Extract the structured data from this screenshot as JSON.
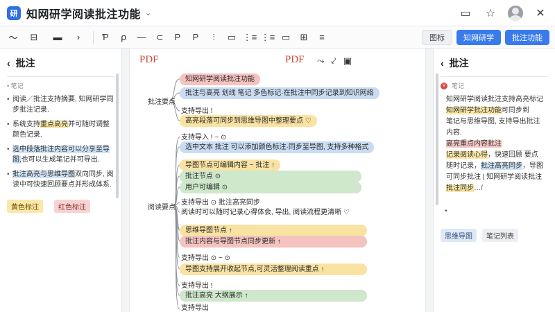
{
  "app": {
    "title": "知网研学阅读批注功能",
    "logo_glyph": "研"
  },
  "toolbar": {
    "tools": [
      "〜",
      "⊟",
      "▬",
      "›",
      "Ƥ",
      "⍴",
      "—",
      "⊂",
      "P",
      "P",
      "⫶",
      "▭",
      "⋮≡",
      "⋮≡",
      "▭",
      "⊞",
      "≡"
    ],
    "btn_ghost": "图标",
    "btn_primary_1": "知网研学",
    "btn_primary_2": "批注功能"
  },
  "left_panel": {
    "title": "批注",
    "sub": "• 笔记",
    "notes": [
      {
        "pre": "",
        "hl": "",
        "hl_color": "",
        "post": "阅读／批注支持摘要, 知网研学同步批注记录."
      },
      {
        "pre": "系统支持",
        "hl": "重点高亮",
        "hl_color": "y",
        "post": "并可随时调整颜色记录."
      },
      {
        "pre": "",
        "hl": "选中段落批注内容可以分享至导图,",
        "hl_color": "b",
        "post": "也可以生成笔记并可导出."
      },
      {
        "pre": "",
        "hl": "批注高亮与思维导图",
        "hl_color": "b",
        "post": "双向同步, 阅读中可快速回顾要点并形成体系."
      }
    ],
    "chip_1": "黄色标注",
    "chip_2": "红色标注"
  },
  "center": {
    "pdf_left": "PDF",
    "pdf_right": "PDF",
    "tools": [
      "⤳",
      "⤦",
      "▣"
    ],
    "branch_1": "批注要点",
    "branch_2": "阅读要点",
    "nodes": [
      {
        "text": "知网研学阅读批注功能",
        "color": "r"
      },
      {
        "text": "批注与高亮 划线 笔记 多色标记·在批注中同步记录到知识网络",
        "color": "b"
      },
      {
        "text": "支持导出 !",
        "color": "plain"
      },
      {
        "text": "高亮段落可同步到思维导图中整理要点 ♡",
        "color": "y"
      },
      {
        "text": "支持导入 ! ~ ⊙",
        "color": "plain"
      },
      {
        "text": "选中文本 批注 可以添加颜色标注·同步至导图, 支持多种格式",
        "color": "b"
      },
      {
        "text": "导图节点可编辑内容 ~ 批注 ↑",
        "color": "y"
      },
      {
        "text": "批注节点 ⊙",
        "color": "g"
      },
      {
        "text": "用户可编辑 ⊙",
        "color": "g"
      },
      {
        "text": "支持导出 ⊙ 批注高亮同步",
        "color": "plain"
      },
      {
        "text": "阅读时可以随时记录心得体会, 导出, 阅读流程更清晰 ♡",
        "color": "plain"
      },
      {
        "text": "思维导图节点 ↑",
        "color": "y"
      },
      {
        "text": "批注内容与导图节点同步更新 ↑",
        "color": "r"
      },
      {
        "text": "支持导出 ⊙ ~ ⊙",
        "color": "plain"
      },
      {
        "text": "导图支持展开收起节点,可灵活整理阅读重点 ↑",
        "color": "y"
      },
      {
        "text": "支持导出 !",
        "color": "plain"
      },
      {
        "text": "批注高亮 大纲展示 ↑",
        "color": "g"
      },
      {
        "text": "支持导出",
        "color": "plain"
      }
    ]
  },
  "right_panel": {
    "title": "批注",
    "user": "笔记",
    "lines": [
      {
        "pre": "知网研学",
        "hl": "",
        "hl_color": "",
        "post": "阅读批注支持高亮标记"
      },
      {
        "pre": "",
        "hl": "知网研学批注功能",
        "hl_color": "y",
        "post": "可同步到"
      },
      {
        "pre": "笔记与思维导图, 支持导出批注",
        "hl": "",
        "hl_color": "",
        "post": ""
      },
      {
        "pre": "",
        "hl": "",
        "hl_color": "",
        "post": "内容."
      },
      {
        "pre": "",
        "hl": "高亮重点内容批注",
        "hl_color": "r",
        "post": ""
      },
      {
        "pre": "",
        "hl": "记录阅读心得",
        "hl_color": "y",
        "post": "，快速回顾 要点"
      },
      {
        "pre": "随时记录，",
        "hl": "批注高亮同步",
        "hl_color": "b",
        "post": "，导图"
      },
      {
        "pre": "可同步批注 | 知网研学阅读批注",
        "hl": "",
        "hl_color": "",
        "post": ""
      },
      {
        "pre": "",
        "hl": "批注同步",
        "hl_color": "y",
        "post": "…/"
      }
    ],
    "dot": "•",
    "chip_1": "思维导图",
    "chip_2": "笔记列表"
  },
  "colors": {
    "accent": "#3a7bec",
    "pdf_red": "#c94b3a",
    "yellow": "#f9e3a3",
    "blue": "#c9dcf3",
    "red": "#f4c3c0",
    "green": "#cfe7cb"
  }
}
